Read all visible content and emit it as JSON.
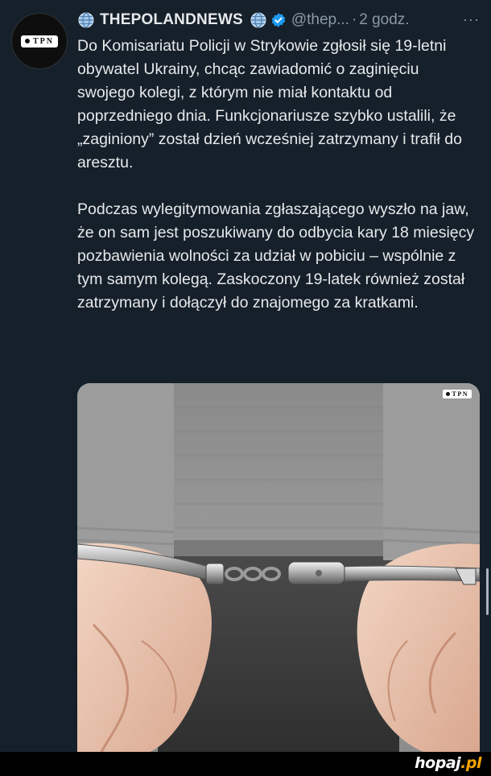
{
  "tweet": {
    "avatar_logo_text": "TPN",
    "display_name": "THEPOLANDNEWS",
    "handle": "@thep...",
    "separator": "·",
    "time": "2 godz.",
    "more_label": "···",
    "paragraphs": [
      "Do Komisariatu Policji w Strykowie zgłosił się 19-letni obywatel Ukrainy, chcąc zawiadomić o zaginięciu swojego kolegi, z którym nie miał kontaktu od poprzedniego dnia. Funkcjonariusze szybko ustalili, że „zaginiony” został dzień wcześniej zatrzymany i trafił do aresztu.",
      "Podczas wylegitymowania zgłaszającego wyszło na jaw, że on sam jest poszukiwany do odbycia kary 18 miesięcy pozbawienia wolności za udział w pobiciu – wspólnie z tym samym kolegą. Zaskoczony 19-latek również został zatrzymany i dołączył do znajomego za kratkami."
    ],
    "media": {
      "watermark_text": "TPN"
    }
  },
  "site": {
    "logo_main": "hopaj",
    "logo_tld": ".pl"
  },
  "colors": {
    "background": "#15202b",
    "verified": "#1d9bf0",
    "secondary_text": "#8b98a5",
    "logo_accent": "#f5a300"
  }
}
